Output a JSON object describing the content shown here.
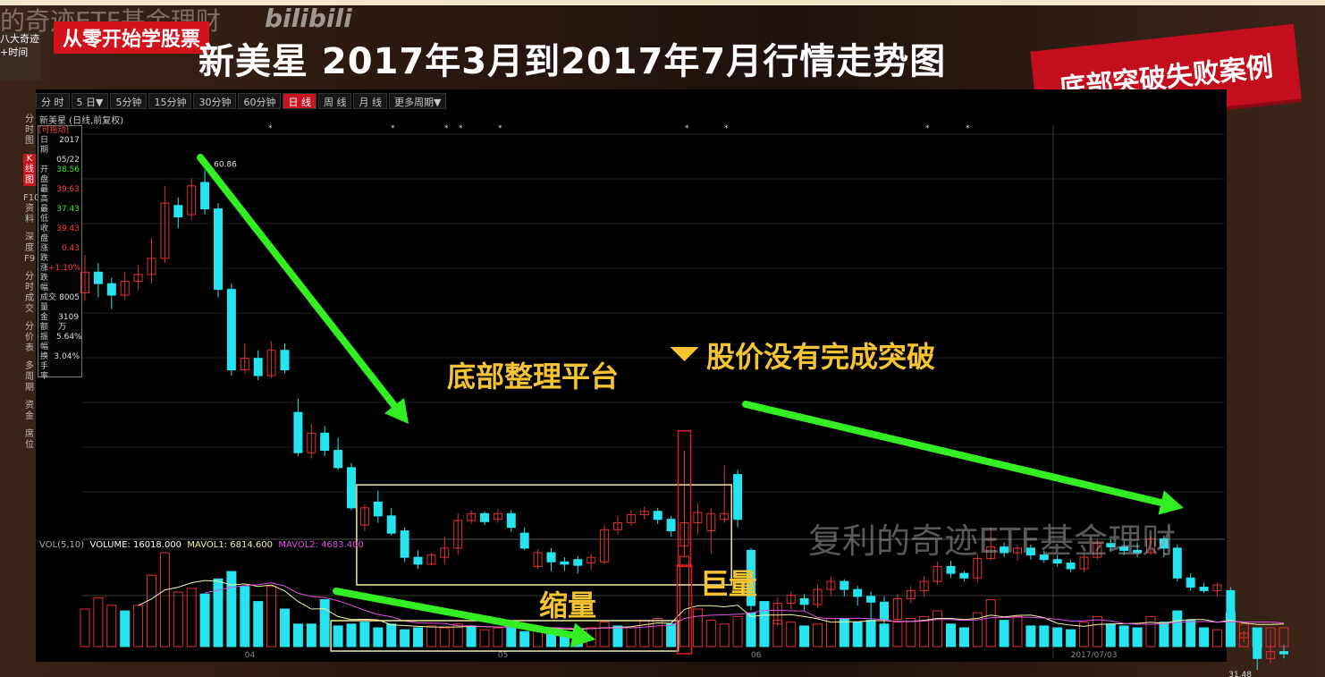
{
  "page": {
    "title": "新美星 2017年3月到2017年7月行情走势图",
    "top_watermark": "的奇迹ETF基金理财",
    "bili_logo": "bilibili",
    "course_tag": "从零开始学股票",
    "avatar_lines": [
      "八大奇迹",
      "+时间"
    ],
    "case_banner": "底部突破失败案例",
    "bottom_watermark": "复利的奇迹ETF基金理财"
  },
  "timeframes": [
    {
      "label": "分 时",
      "active": false
    },
    {
      "label": "5 日▼",
      "active": false
    },
    {
      "label": "5分钟",
      "active": false
    },
    {
      "label": "15分钟",
      "active": false
    },
    {
      "label": "30分钟",
      "active": false
    },
    {
      "label": "60分钟",
      "active": false
    },
    {
      "label": "日 线",
      "active": true
    },
    {
      "label": "周 线",
      "active": false
    },
    {
      "label": "月 线",
      "active": false
    },
    {
      "label": "更多周期▼",
      "active": false
    }
  ],
  "side_tabs": [
    {
      "label": "分时图",
      "active": false
    },
    {
      "label": "K线图",
      "active": true
    },
    {
      "label": "F10资料",
      "active": false
    },
    {
      "label": "深度F9",
      "active": false
    },
    {
      "label": "分时成交",
      "active": false
    },
    {
      "label": "分价表",
      "active": false
    },
    {
      "label": "多周期",
      "active": false
    },
    {
      "label": "资金",
      "active": false
    },
    {
      "label": "席位",
      "active": false
    }
  ],
  "stock_label": "新美星 (日线,前复权)",
  "info_panel": {
    "header": "[可拖动]",
    "rows": [
      {
        "k": "日　期",
        "v": "2017",
        "c": "wht"
      },
      {
        "k": "",
        "v": "05/22",
        "c": "wht"
      },
      {
        "k": "开　盘",
        "v": "38.56",
        "c": "grn"
      },
      {
        "k": "最　高",
        "v": "39.63",
        "c": "red"
      },
      {
        "k": "最　低",
        "v": "37.43",
        "c": "grn"
      },
      {
        "k": "收　盘",
        "v": "39.43",
        "c": "red"
      },
      {
        "k": "涨　跌",
        "v": "0.43",
        "c": "red"
      },
      {
        "k": "涨跌幅",
        "v": "+1.10%",
        "c": "red"
      },
      {
        "k": "成交量",
        "v": "8005",
        "c": "wht"
      },
      {
        "k": "金　额",
        "v": "3109万",
        "c": "wht"
      },
      {
        "k": "振　幅",
        "v": "5.64%",
        "c": "wht"
      },
      {
        "k": "换手率",
        "v": "3.04%",
        "c": "wht"
      }
    ]
  },
  "volume_legend": {
    "name": "VOL(5,10)",
    "volume": "VOLUME: 16018.000",
    "mavol1": "MAVOL1: 6814.600",
    "mavol2": "MAVOL2: 4683.400"
  },
  "annotations": {
    "platform": "底部整理平台",
    "no_breakout": "股价没有完成突破",
    "shrink": "缩量",
    "huge": "巨量"
  },
  "colors": {
    "up": "#e03030",
    "down": "#26e3f0",
    "arrow": "#33ee22",
    "box": "#f3e6a0",
    "highlight": "#e0201c",
    "annotation": "#f6c431"
  },
  "chart_data": {
    "type": "candlestick",
    "title": "新美星 2017年3月到2017年7月行情走势图",
    "y_unit": "CNY",
    "price_labels": {
      "high": "60.86",
      "low": "31.48"
    },
    "x_ticks": [
      {
        "index": 12,
        "label": "04"
      },
      {
        "index": 31,
        "label": "05"
      },
      {
        "index": 50,
        "label": "06"
      },
      {
        "index": 74,
        "label": "2017/07/03"
      }
    ],
    "ylim": [
      29,
      64
    ],
    "candles": [
      [
        50.2,
        52.0,
        53.5,
        49.5
      ],
      [
        52.0,
        51.0,
        52.8,
        49.8
      ],
      [
        51.0,
        50.0,
        51.5,
        48.8
      ],
      [
        50.0,
        51.2,
        52.0,
        49.6
      ],
      [
        51.2,
        51.8,
        52.6,
        50.4
      ],
      [
        51.8,
        53.2,
        55.0,
        51.0
      ],
      [
        53.2,
        58.0,
        59.5,
        52.8
      ],
      [
        57.8,
        56.8,
        58.5,
        55.8
      ],
      [
        57.0,
        59.5,
        60.2,
        56.5
      ],
      [
        59.8,
        57.5,
        60.86,
        57.0
      ],
      [
        57.5,
        50.5,
        58.0,
        49.8
      ],
      [
        50.5,
        43.5,
        51.0,
        43.0
      ],
      [
        43.5,
        44.5,
        45.8,
        43.2
      ],
      [
        44.5,
        43.0,
        45.2,
        42.6
      ],
      [
        43.0,
        45.2,
        46.0,
        42.8
      ],
      [
        45.2,
        43.5,
        45.8,
        43.2
      ],
      [
        39.8,
        36.3,
        41.0,
        36.0
      ],
      [
        36.3,
        38.0,
        38.8,
        35.8
      ],
      [
        38.0,
        36.5,
        38.6,
        36.0
      ],
      [
        36.5,
        35.0,
        37.6,
        34.8
      ],
      [
        35.0,
        31.5,
        35.4,
        31.3
      ],
      [
        30.0,
        31.5,
        31.8,
        29.5
      ],
      [
        32.0,
        30.8,
        33.0,
        30.2
      ],
      [
        30.8,
        29.3,
        31.5,
        29.1
      ],
      [
        29.5,
        27.2,
        29.8,
        26.8
      ],
      [
        27.2,
        26.6,
        27.8,
        26.2
      ],
      [
        26.6,
        27.4,
        27.6,
        26.5
      ],
      [
        27.2,
        28.0,
        29.0,
        26.6
      ],
      [
        28.0,
        30.4,
        31.0,
        27.4
      ],
      [
        30.4,
        31.0,
        31.3,
        30.1
      ],
      [
        31.0,
        30.3,
        31.2,
        30.0
      ],
      [
        30.5,
        31.0,
        31.4,
        30.2
      ],
      [
        31.0,
        29.8,
        31.3,
        29.4
      ],
      [
        29.3,
        28.0,
        29.8,
        27.8
      ],
      [
        26.4,
        27.6,
        27.9,
        26.2
      ],
      [
        27.6,
        26.8,
        28.0,
        26.0
      ],
      [
        26.8,
        26.6,
        27.2,
        26.0
      ],
      [
        27.0,
        26.5,
        27.3,
        25.8
      ],
      [
        26.7,
        27.2,
        27.5,
        26.1
      ],
      [
        26.8,
        29.6,
        30.0,
        26.6
      ],
      [
        29.6,
        30.2,
        30.8,
        29.2
      ],
      [
        30.2,
        30.9,
        31.3,
        29.9
      ],
      [
        30.9,
        31.2,
        31.6,
        30.5
      ],
      [
        31.2,
        30.5,
        31.5,
        30.1
      ],
      [
        30.5,
        29.5,
        30.8,
        29.0
      ],
      [
        28.2,
        30.2,
        36.5,
        27.2
      ],
      [
        30.2,
        31.1,
        31.9,
        29.2
      ],
      [
        29.5,
        31.0,
        31.5,
        27.5
      ],
      [
        30.5,
        31.0,
        35.2,
        30.2
      ],
      [
        34.4,
        30.5,
        34.8,
        29.8
      ],
      [
        27.8,
        23.0,
        28.0,
        22.6
      ],
      [
        23.0,
        21.4,
        23.3,
        20.8
      ],
      [
        21.4,
        23.2,
        23.7,
        21.2
      ],
      [
        23.2,
        23.9,
        24.2,
        22.7
      ],
      [
        23.6,
        23.1,
        24.0,
        22.6
      ],
      [
        23.1,
        24.4,
        24.8,
        22.8
      ],
      [
        24.4,
        25.1,
        25.5,
        23.9
      ],
      [
        25.1,
        24.4,
        25.3,
        23.8
      ],
      [
        24.4,
        23.8,
        24.7,
        23.0
      ],
      [
        23.8,
        23.3,
        24.2,
        20.6
      ],
      [
        23.3,
        21.8,
        23.8,
        21.2
      ],
      [
        21.8,
        23.6,
        24.0,
        21.6
      ],
      [
        23.6,
        24.3,
        24.7,
        23.2
      ],
      [
        24.3,
        25.1,
        25.6,
        23.8
      ],
      [
        25.1,
        26.4,
        26.8,
        24.8
      ],
      [
        26.4,
        25.8,
        26.9,
        25.4
      ],
      [
        25.8,
        25.4,
        26.0,
        25.1
      ],
      [
        25.4,
        27.1,
        27.5,
        25.0
      ],
      [
        27.1,
        28.1,
        29.8,
        26.9
      ],
      [
        28.1,
        27.6,
        28.5,
        27.2
      ],
      [
        27.6,
        28.0,
        28.3,
        26.9
      ],
      [
        28.0,
        27.4,
        28.3,
        27.0
      ],
      [
        27.4,
        27.0,
        27.8,
        26.7
      ],
      [
        27.0,
        26.7,
        27.4,
        26.4
      ],
      [
        26.7,
        26.2,
        27.0,
        25.9
      ],
      [
        26.2,
        27.2,
        27.5,
        25.9
      ],
      [
        27.2,
        28.4,
        28.8,
        27.0
      ],
      [
        28.4,
        28.1,
        28.8,
        27.8
      ],
      [
        28.1,
        27.8,
        28.6,
        27.4
      ],
      [
        27.8,
        27.6,
        28.5,
        27.2
      ],
      [
        27.6,
        28.8,
        29.0,
        27.4
      ],
      [
        28.8,
        28.0,
        29.1,
        27.2
      ],
      [
        28.0,
        25.4,
        28.3,
        25.1
      ],
      [
        25.4,
        24.6,
        25.8,
        24.3
      ],
      [
        24.6,
        24.3,
        25.0,
        24.1
      ],
      [
        24.3,
        24.8,
        25.0,
        23.8
      ],
      [
        24.3,
        20.2,
        24.6,
        19.8
      ],
      [
        20.2,
        20.6,
        20.8,
        19.8
      ],
      [
        19.6,
        18.4,
        20.0,
        17.4
      ],
      [
        18.4,
        19.0,
        20.9,
        18.0
      ],
      [
        19.0,
        18.8,
        19.6,
        18.4
      ]
    ],
    "volume": [
      [
        2.0,
        0
      ],
      [
        2.6,
        0
      ],
      [
        2.2,
        0
      ],
      [
        1.9,
        1
      ],
      [
        2.2,
        0
      ],
      [
        3.8,
        0
      ],
      [
        5.0,
        0
      ],
      [
        2.9,
        0
      ],
      [
        3.1,
        0
      ],
      [
        2.8,
        1
      ],
      [
        3.6,
        1
      ],
      [
        4.0,
        1
      ],
      [
        3.2,
        1
      ],
      [
        2.4,
        1
      ],
      [
        3.2,
        0
      ],
      [
        2.0,
        1
      ],
      [
        1.2,
        1
      ],
      [
        1.2,
        1
      ],
      [
        2.5,
        1
      ],
      [
        1.1,
        1
      ],
      [
        1.2,
        1
      ],
      [
        1.3,
        1
      ],
      [
        1.0,
        1
      ],
      [
        1.2,
        1
      ],
      [
        0.9,
        1
      ],
      [
        1.0,
        1
      ],
      [
        1.1,
        0
      ],
      [
        1.0,
        0
      ],
      [
        1.2,
        0
      ],
      [
        1.1,
        1
      ],
      [
        0.9,
        0
      ],
      [
        1.0,
        0
      ],
      [
        1.0,
        1
      ],
      [
        0.8,
        1
      ],
      [
        1.1,
        0
      ],
      [
        1.0,
        1
      ],
      [
        0.8,
        1
      ],
      [
        0.9,
        1
      ],
      [
        1.0,
        0
      ],
      [
        1.3,
        0
      ],
      [
        1.1,
        1
      ],
      [
        1.0,
        0
      ],
      [
        1.4,
        0
      ],
      [
        1.5,
        0
      ],
      [
        1.2,
        1
      ],
      [
        4.8,
        0
      ],
      [
        2.0,
        0
      ],
      [
        1.4,
        0
      ],
      [
        1.2,
        0
      ],
      [
        1.6,
        0
      ],
      [
        1.8,
        1
      ],
      [
        2.4,
        1
      ],
      [
        1.4,
        0
      ],
      [
        1.3,
        0
      ],
      [
        1.1,
        1
      ],
      [
        1.2,
        0
      ],
      [
        1.5,
        0
      ],
      [
        1.5,
        1
      ],
      [
        1.3,
        1
      ],
      [
        1.4,
        1
      ],
      [
        1.2,
        1
      ],
      [
        1.3,
        0
      ],
      [
        1.5,
        0
      ],
      [
        1.6,
        0
      ],
      [
        1.9,
        0
      ],
      [
        1.2,
        1
      ],
      [
        1.0,
        1
      ],
      [
        1.8,
        0
      ],
      [
        2.5,
        0
      ],
      [
        1.4,
        1
      ],
      [
        1.6,
        0
      ],
      [
        1.1,
        1
      ],
      [
        1.1,
        1
      ],
      [
        1.0,
        1
      ],
      [
        0.9,
        1
      ],
      [
        1.3,
        0
      ],
      [
        1.6,
        0
      ],
      [
        1.2,
        1
      ],
      [
        1.1,
        1
      ],
      [
        1.0,
        1
      ],
      [
        1.6,
        0
      ],
      [
        1.3,
        1
      ],
      [
        1.9,
        1
      ],
      [
        1.4,
        1
      ],
      [
        1.0,
        1
      ],
      [
        0.9,
        0
      ],
      [
        1.8,
        1
      ],
      [
        1.2,
        0
      ],
      [
        1.0,
        1
      ],
      [
        1.0,
        0
      ],
      [
        1.0,
        0
      ]
    ]
  }
}
